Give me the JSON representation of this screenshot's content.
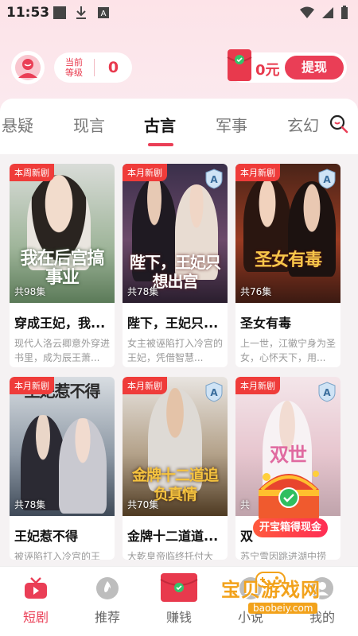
{
  "status_bar": {
    "time": "11:53"
  },
  "header": {
    "level_label_line1": "当前",
    "level_label_line2": "等级",
    "level_value": "0",
    "wallet_amount": "0元",
    "withdraw_label": "提现"
  },
  "tabs": [
    {
      "label": "悬疑",
      "active": false
    },
    {
      "label": "现言",
      "active": false
    },
    {
      "label": "古言",
      "active": true
    },
    {
      "label": "军事",
      "active": false
    },
    {
      "label": "玄幻",
      "active": false
    }
  ],
  "dramas": [
    {
      "badge": "本周新剧",
      "poster_text": "我在后宫搞事业",
      "episodes": "共98集",
      "title": "穿成王妃，我...",
      "desc": "现代人洛云卿意外穿进书里，成为辰王萧..."
    },
    {
      "badge": "本月新剧",
      "poster_text": "陛下，王妃只想出宫",
      "episodes": "共78集",
      "title": "陛下，王妃只...",
      "desc": "女主被诬陷打入冷宫的王妃，凭借智慧..."
    },
    {
      "badge": "本月新剧",
      "poster_text": "圣女有毒",
      "episodes": "共76集",
      "title": "圣女有毒",
      "desc": "上一世，江徽宁身为圣女，心怀天下，用..."
    },
    {
      "badge": "本月新剧",
      "poster_text": "王妃惹不得",
      "episodes": "共78集",
      "title": "王妃惹不得",
      "desc": "被诬陷打入冷宫的王"
    },
    {
      "badge": "本月新剧",
      "poster_text": "金牌十二道追负真情",
      "episodes": "共70集",
      "title": "金牌十二道道...",
      "desc": "大乾皇帝临终托付大"
    },
    {
      "badge": "本月新剧",
      "poster_text": "双世",
      "episodes": "共",
      "title": "双",
      "desc": "苏宁雪因跳进湖中捞"
    }
  ],
  "treasure_chest_label": "开宝箱得现金",
  "bottom_nav": [
    {
      "label": "短剧",
      "active": true
    },
    {
      "label": "推荐",
      "active": false
    },
    {
      "label": "赚钱",
      "active": false
    },
    {
      "label": "小说",
      "active": false
    },
    {
      "label": "我的",
      "active": false
    }
  ],
  "watermark": {
    "main": "宝贝游戏网",
    "sub": "baobeiy.com"
  },
  "colors": {
    "accent": "#ea3e56",
    "badge": "#ef3c3a"
  }
}
